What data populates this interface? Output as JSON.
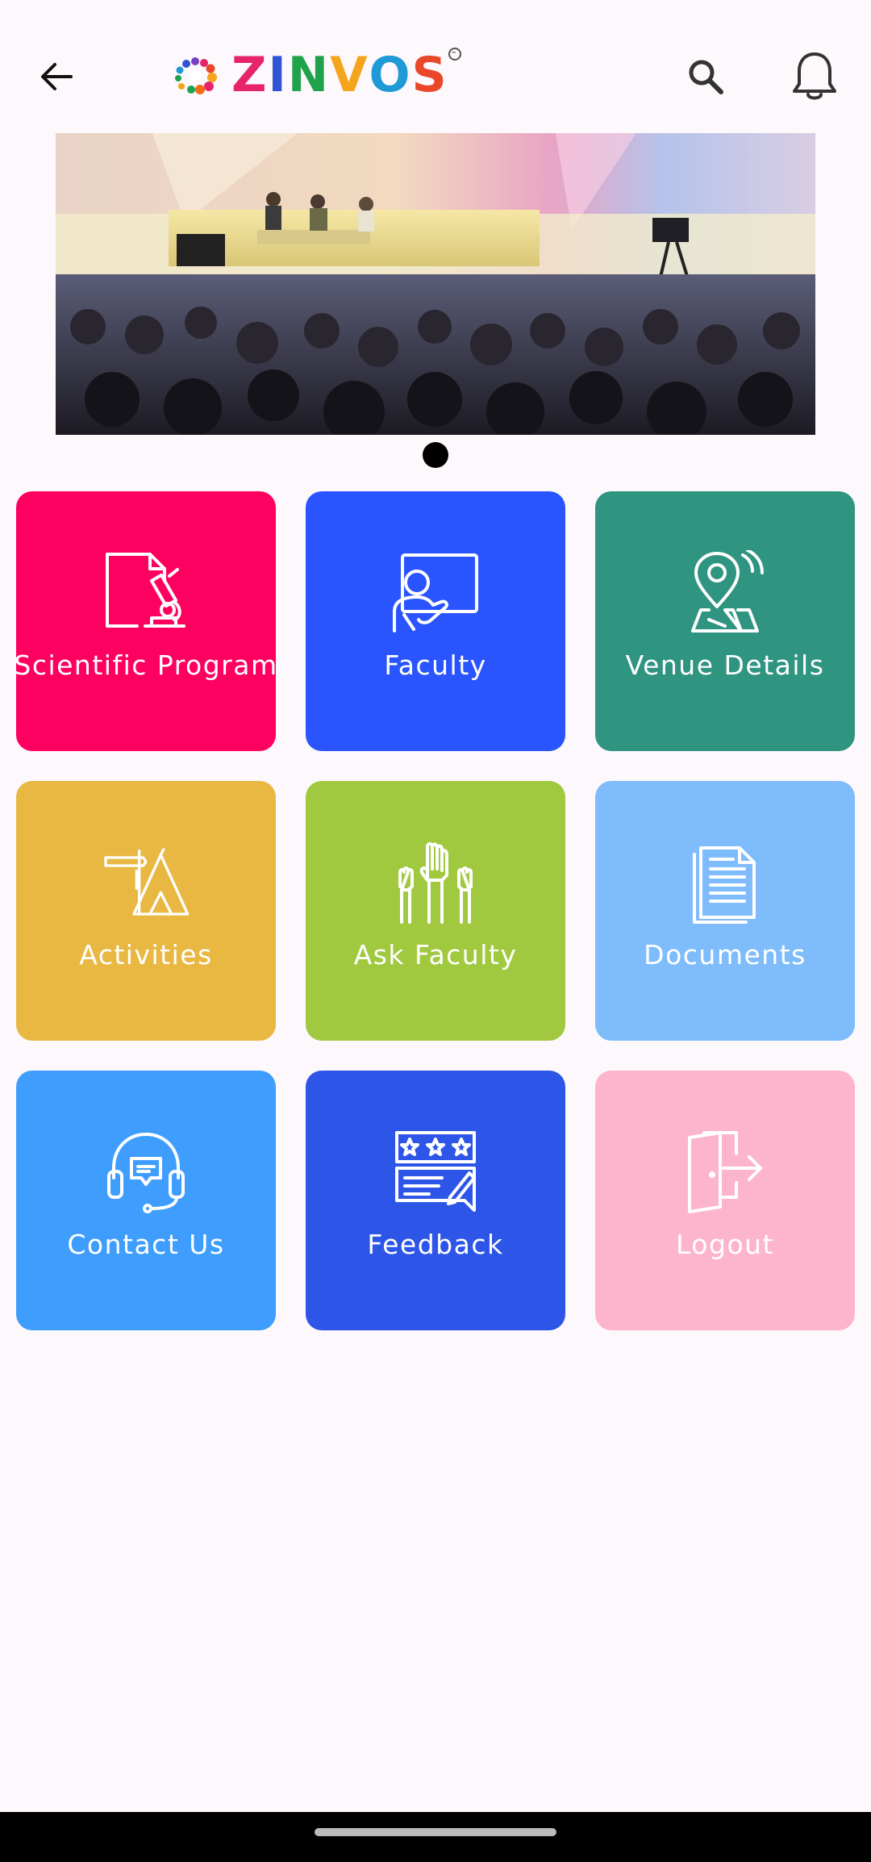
{
  "header": {
    "logo_letters": [
      {
        "char": "Z",
        "color": "#e6246b"
      },
      {
        "char": "I",
        "color": "#2f55d4"
      },
      {
        "char": "N",
        "color": "#1fa34a"
      },
      {
        "char": "V",
        "color": "#f4a51c"
      },
      {
        "char": "O",
        "color": "#1f9ad6"
      },
      {
        "char": "S",
        "color": "#e9472a"
      }
    ],
    "trademark": "™",
    "icons": {
      "back": "arrow-left-icon",
      "search": "search-icon",
      "notifications": "bell-icon"
    }
  },
  "banner": {
    "description_icon": "conference-photo",
    "carousel_dots": 1,
    "active_dot": 0
  },
  "tiles": [
    {
      "label": "Scientific Program",
      "color": "#fe0060",
      "icon": "document-microscope-icon"
    },
    {
      "label": "Faculty",
      "color": "#2a55fe",
      "icon": "presenter-screen-icon"
    },
    {
      "label": "Venue Details",
      "color": "#2f9480",
      "icon": "map-pin-icon"
    },
    {
      "label": "Activities",
      "color": "#e8b843",
      "icon": "signpost-tent-icon"
    },
    {
      "label": "Ask Faculty",
      "color": "#a1c940",
      "icon": "raised-hands-icon"
    },
    {
      "label": "Documents",
      "color": "#7fbcfb",
      "icon": "documents-icon"
    },
    {
      "label": "Contact Us",
      "color": "#3f9efd",
      "icon": "headset-chat-icon"
    },
    {
      "label": "Feedback",
      "color": "#2d56e8",
      "icon": "rating-chat-icon"
    },
    {
      "label": "Logout",
      "color": "#fdb5cd",
      "icon": "logout-door-icon"
    }
  ]
}
